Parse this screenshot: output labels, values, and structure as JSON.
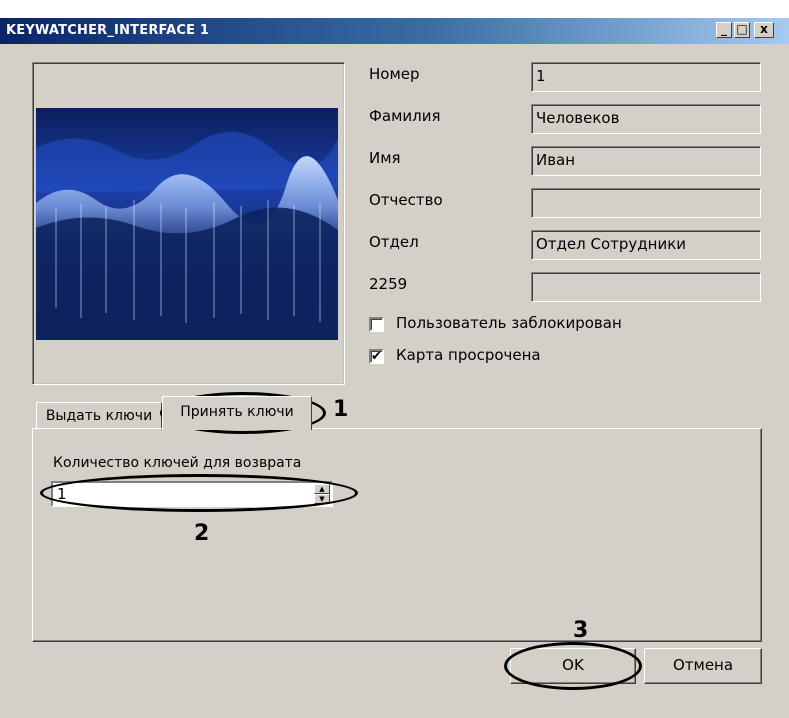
{
  "window": {
    "title": "KEYWATCHER_INTERFACE 1",
    "controls": {
      "minimize": "_",
      "maximize": "□",
      "close": "x"
    }
  },
  "photo": {
    "description_icon": "forest-photo"
  },
  "fields": [
    {
      "label": "Номер",
      "value": "1"
    },
    {
      "label": "Фамилия",
      "value": "Человеков"
    },
    {
      "label": "Имя",
      "value": "Иван"
    },
    {
      "label": "Отчество",
      "value": ""
    },
    {
      "label": "Отдел",
      "value": "Отдел Сотрудники"
    },
    {
      "label": "2259",
      "value": ""
    }
  ],
  "checkboxes": [
    {
      "label": "Пользователь заблокирован",
      "checked": false,
      "mark": ""
    },
    {
      "label": "Карта просрочена",
      "checked": true,
      "mark": "✔"
    }
  ],
  "tabs": [
    {
      "label": "Выдать ключи",
      "active": false
    },
    {
      "label": "Принять ключи",
      "active": true
    }
  ],
  "return_panel": {
    "label": "Количество ключей для возврата",
    "value": "1"
  },
  "buttons": {
    "ok": "OK",
    "cancel": "Отмена"
  },
  "annotations": [
    "1",
    "2",
    "3"
  ],
  "colors": {
    "title_start": "#0a246a",
    "title_end": "#a6caf0",
    "face": "#d4d0c8"
  }
}
